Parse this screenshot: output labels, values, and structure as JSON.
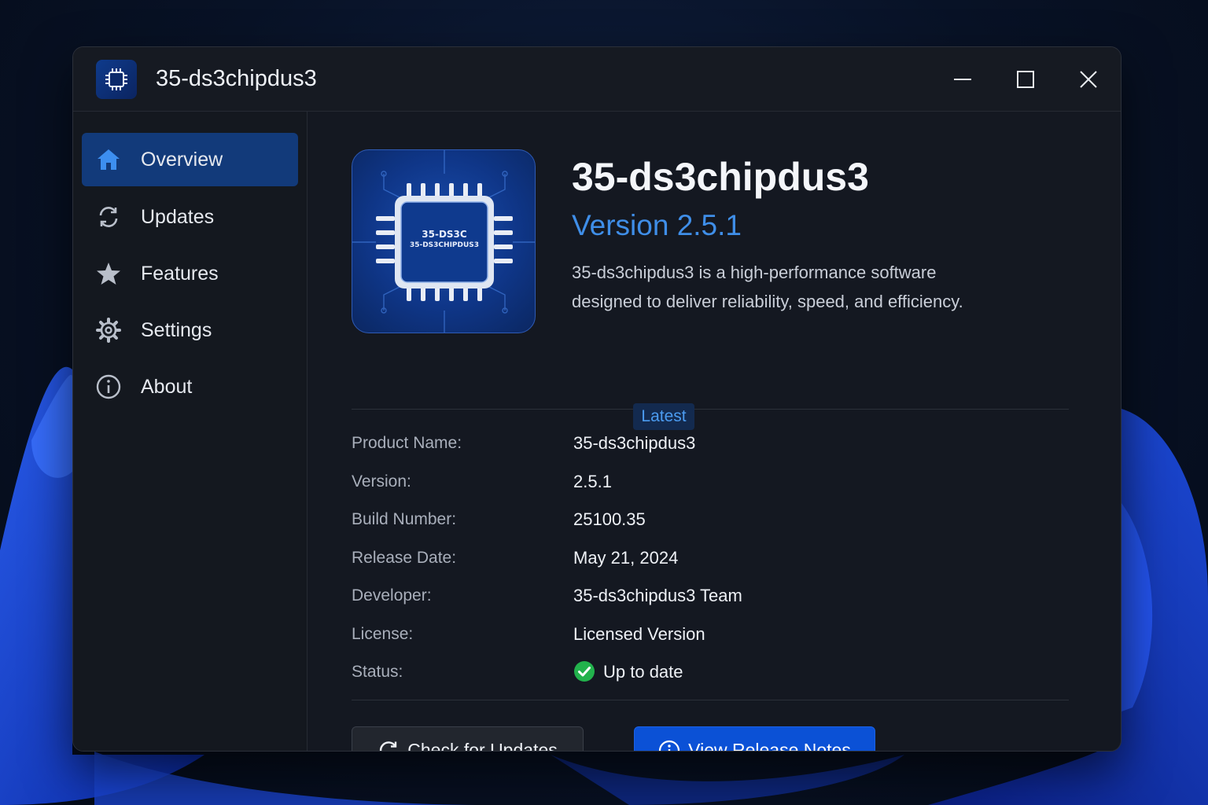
{
  "window": {
    "title": "35-ds3chipdus3"
  },
  "sidebar": {
    "items": [
      {
        "label": "Overview",
        "icon": "home-icon",
        "active": true
      },
      {
        "label": "Updates",
        "icon": "refresh-icon",
        "active": false
      },
      {
        "label": "Features",
        "icon": "star-icon",
        "active": false
      },
      {
        "label": "Settings",
        "icon": "gear-icon",
        "active": false
      },
      {
        "label": "About",
        "icon": "info-icon",
        "active": false
      }
    ]
  },
  "header": {
    "icon_text_line1": "35-DS3C",
    "icon_text_line2": "35-DS3CHIPDUS3",
    "app_name": "35-ds3chipdus3",
    "version": "Version 2.5.1",
    "description": "35-ds3chipdus3 is a high-performance software designed to deliver reliability, speed, and efficiency."
  },
  "info": {
    "rows": [
      {
        "label": "Product Name:",
        "value": "35-ds3chipdus3"
      },
      {
        "label": "Version:",
        "value": "2.5.1"
      },
      {
        "label": "Build Number:",
        "value": "25100.35"
      },
      {
        "label": "Release Date:",
        "value": "May 21, 2024"
      },
      {
        "label": "Developer:",
        "value": "35-ds3chipdus3 Team"
      },
      {
        "label": "License:",
        "value": "Licensed Version"
      },
      {
        "label": "Status:",
        "value": "Up to date"
      }
    ],
    "version_badge": "Latest"
  },
  "actions": {
    "check_updates": "Check for Updates",
    "release_notes": "View Release Notes"
  },
  "colors": {
    "accent": "#3f8ee8",
    "primary_button": "#0b51d6",
    "active_nav": "#123a7a",
    "status_ok": "#22b24c"
  }
}
